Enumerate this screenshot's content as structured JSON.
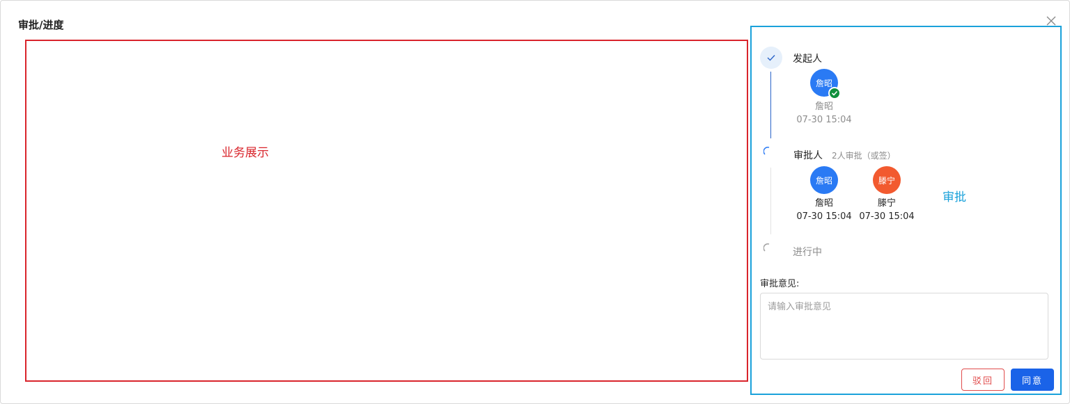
{
  "dialog": {
    "title": "审批/进度"
  },
  "business": {
    "label": "业务展示"
  },
  "approval": {
    "annotation": "审批",
    "steps": [
      {
        "title": "发起人",
        "status": "done",
        "people": [
          {
            "avatar_text": "詹昭",
            "name": "詹昭",
            "time": "07-30 15:04",
            "color": "#2a7af4",
            "done": true
          }
        ]
      },
      {
        "title": "审批人",
        "subtitle": "2人审批（或签）",
        "status": "in-progress",
        "people": [
          {
            "avatar_text": "詹昭",
            "name": "詹昭",
            "time": "07-30 15:04",
            "color": "#2a7af4"
          },
          {
            "avatar_text": "滕宁",
            "name": "滕宁",
            "time": "07-30 15:04",
            "color": "#f25a2f"
          }
        ]
      },
      {
        "title": "进行中",
        "status": "pending"
      }
    ],
    "opinion_label": "审批意见:",
    "opinion_placeholder": "请输入审批意见",
    "reject_label": "驳回",
    "agree_label": "同意"
  },
  "colors": {
    "business_border": "#d9242b",
    "approval_border": "#1aa1da",
    "primary": "#1a63e8",
    "danger": "#e04b4b"
  }
}
